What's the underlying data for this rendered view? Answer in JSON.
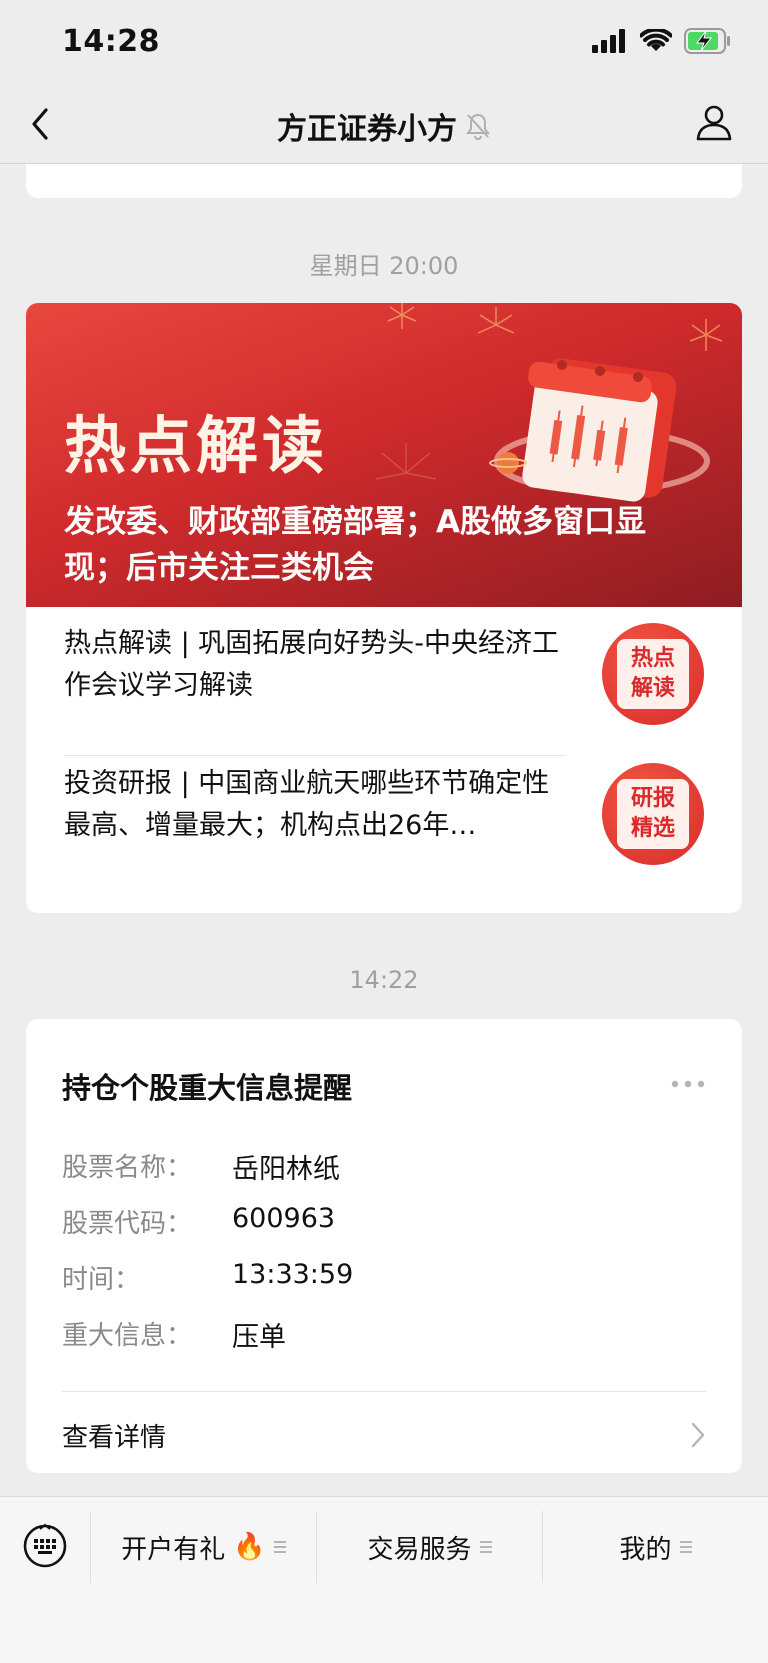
{
  "status_bar": {
    "time": "14:28"
  },
  "nav": {
    "title": "方正证券小方"
  },
  "messages": [
    {
      "timestamp": "星期日 20:00",
      "banner": {
        "title": "热点解读",
        "subtitle": "发改委、财政部重磅部署；A股做多窗口显现；后市关注三类机会"
      },
      "items": [
        {
          "text": "热点解读 | 巩固拓展向好势头-中央经济工作会议学习解读",
          "thumb": "热点解读"
        },
        {
          "text": "投资研报 | 中国商业航天哪些环节确定性最高、增量最大；机构点出26年…",
          "thumb": "研报精选"
        }
      ]
    },
    {
      "timestamp": "14:22",
      "alert": {
        "title": "持仓个股重大信息提醒",
        "fields": [
          {
            "label": "股票名称：",
            "value": "岳阳林纸"
          },
          {
            "label": "股票代码：",
            "value": "600963"
          },
          {
            "label": "时间：",
            "value": "13:33:59"
          },
          {
            "label": "重大信息：",
            "value": "压单"
          }
        ],
        "link_label": "查看详情"
      }
    }
  ],
  "bottom_menu": {
    "items": [
      {
        "label": "开户有礼",
        "emoji": "🔥"
      },
      {
        "label": "交易服务"
      },
      {
        "label": "我的"
      }
    ]
  },
  "colors": {
    "accent_red": "#d9292a",
    "battery_green": "#4cd964"
  }
}
